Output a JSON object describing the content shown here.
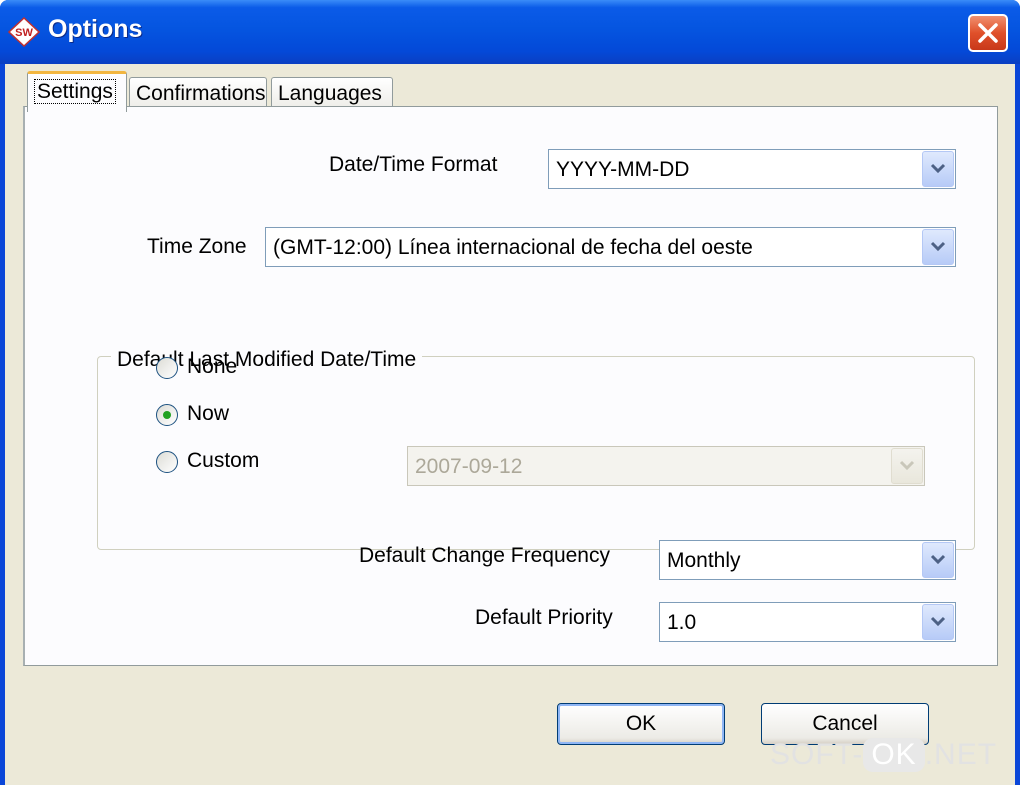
{
  "window": {
    "title": "Options",
    "icon": "sw-logo-icon",
    "close_icon": "close-icon"
  },
  "tabs": [
    {
      "label": "Settings",
      "active": true
    },
    {
      "label": "Confirmations",
      "active": false
    },
    {
      "label": "Languages",
      "active": false
    }
  ],
  "settings": {
    "date_time_format": {
      "label": "Date/Time Format",
      "value": "YYYY-MM-DD"
    },
    "time_zone": {
      "label": "Time Zone",
      "value": "(GMT-12:00) Línea internacional de fecha del oeste"
    },
    "default_last_modified": {
      "legend": "Default Last Modified Date/Time",
      "options": [
        {
          "label": "None",
          "selected": false
        },
        {
          "label": "Now",
          "selected": true
        },
        {
          "label": "Custom",
          "selected": false
        }
      ],
      "custom_date": {
        "value": "2007-09-12",
        "enabled": false
      }
    },
    "change_frequency": {
      "label": "Default Change Frequency",
      "value": "Monthly"
    },
    "priority": {
      "label": "Default Priority",
      "value": "1.0"
    }
  },
  "buttons": {
    "ok": "OK",
    "cancel": "Cancel"
  },
  "watermark": {
    "part1": "SOFT-",
    "part2": "OK",
    "part3": ".NET"
  },
  "colors": {
    "titlebar": "#0555e0",
    "dialog_bg": "#ece9d8",
    "close_button": "#e0502a",
    "radio_dot": "#21a121"
  }
}
